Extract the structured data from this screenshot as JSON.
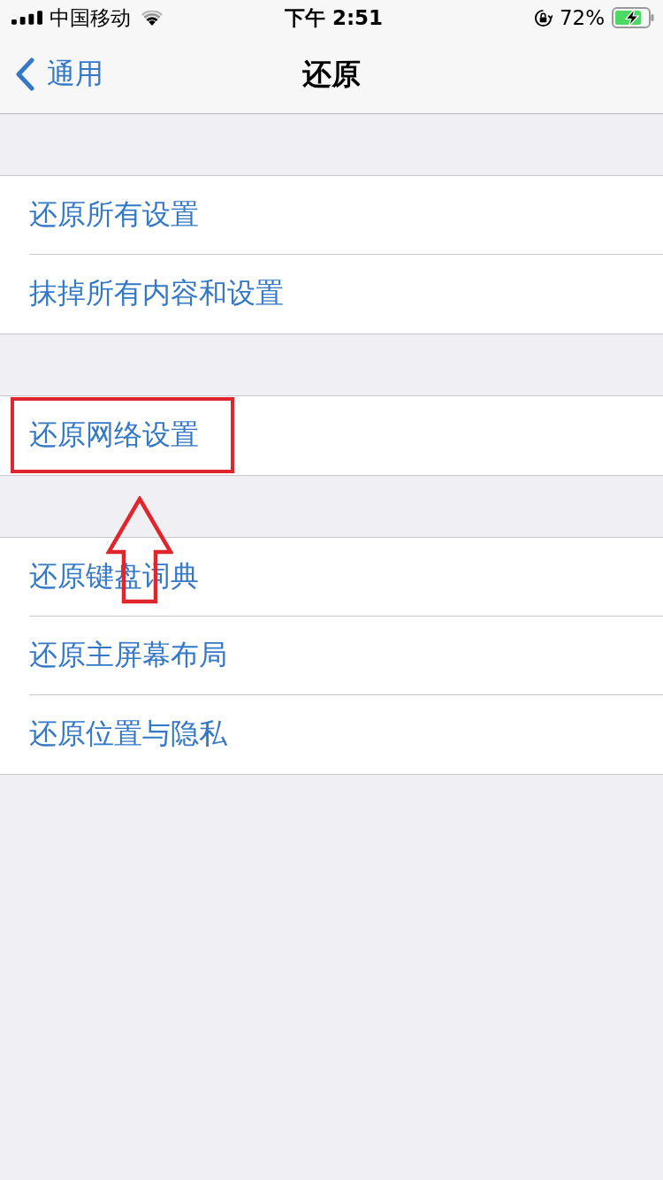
{
  "status_bar": {
    "carrier": "中国移动",
    "time": "下午 2:51",
    "battery_percent": "72%",
    "charging": true
  },
  "nav": {
    "back": "通用",
    "title": "还原"
  },
  "sections": [
    {
      "rows": [
        {
          "label": "还原所有设置",
          "highlighted": false
        },
        {
          "label": "抹掉所有内容和设置",
          "highlighted": false
        }
      ]
    },
    {
      "rows": [
        {
          "label": "还原网络设置",
          "highlighted": true
        }
      ]
    },
    {
      "rows": [
        {
          "label": "还原键盘词典",
          "highlighted": false
        },
        {
          "label": "还原主屏幕布局",
          "highlighted": false
        },
        {
          "label": "还原位置与隐私",
          "highlighted": false
        }
      ]
    }
  ]
}
